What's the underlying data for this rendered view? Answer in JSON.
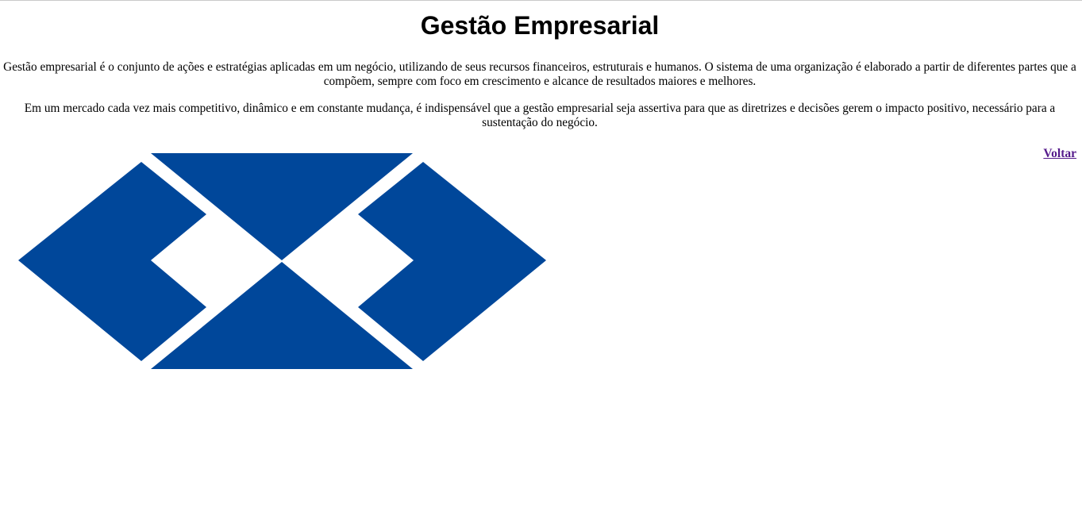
{
  "page": {
    "title": "Gestão Empresarial",
    "paragraphs": [
      "Gestão empresarial é o conjunto de ações e estratégias aplicadas em um negócio, utilizando de seus recursos financeiros, estruturais e humanos. O sistema de uma organização é elaborado a partir de diferentes partes que a compõem, sempre com foco em crescimento e alcance de resultados maiores e melhores.",
      "Em um mercado cada vez mais competitivo, dinâmico e em constante mudança, é indispensável que a gestão empresarial seja assertiva para que as diretrizes e decisões gerem o impacto positivo, necessário para a sustentação do negócio."
    ],
    "back_link": "Voltar"
  },
  "logo": {
    "icon": "blue-geometric-logo-icon",
    "color": "#00479a"
  },
  "colors": {
    "link_visited": "#551a8b",
    "background": "#ffffff",
    "text": "#000000"
  }
}
